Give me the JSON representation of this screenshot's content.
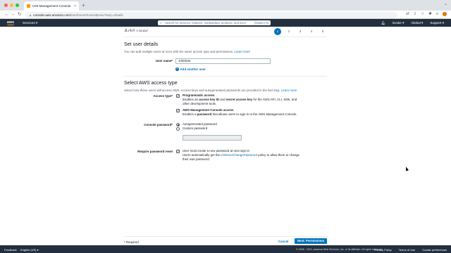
{
  "browser": {
    "tab_title": "IAM Management Console",
    "tab_close": "×",
    "new_tab": "+",
    "url_host": "console.aws.amazon.com",
    "url_path": "/iam/home#/users$new?step=details",
    "back": "←",
    "forward": "→",
    "reload": "↻",
    "traffic_colors": [
      "#ff5f57",
      "#febc2e",
      "#28c840"
    ]
  },
  "aws_nav": {
    "logo": "aws",
    "services": "Services ▾",
    "search_placeholder": "Search for services, features, marketplace products, and docs",
    "search_shortcut": "[Option+S]",
    "user": "invoke ▾",
    "region": "Global ▾",
    "support": "Support ▾"
  },
  "page": {
    "title": "Add user",
    "steps": [
      "1",
      "2",
      "3",
      "4",
      "5"
    ],
    "active_step": "1",
    "set_user_details": {
      "heading": "Set user details",
      "description": "You can add multiple users at once with the same access type and permissions.",
      "learn_more": "Learn more",
      "user_name_label": "User name*",
      "user_name_value": "JohnDoe",
      "add_another_user": "Add another user"
    },
    "access_type": {
      "heading": "Select AWS access type",
      "description": "Select how these users will access AWS. Access keys and autogenerated passwords are provided in the last step.",
      "learn_more": "Learn more",
      "label": "Access type*",
      "programmatic": {
        "checked": true,
        "title": "Programmatic access",
        "line1_pre": "Enables an ",
        "line1_b1": "access key ID",
        "line1_mid": " and ",
        "line1_b2": "secret access key",
        "line1_post": " for the AWS API, CLI, SDK, and",
        "line2": "other development tools."
      },
      "console": {
        "checked": true,
        "title": "AWS Management Console access",
        "line1_pre": "Enables a ",
        "line1_b": "password",
        "line1_post": " that allows users to sign-in to the AWS Management Console."
      }
    },
    "console_password": {
      "label": "Console password*",
      "autogenerated": "Autogenerated password",
      "custom": "Custom password"
    },
    "require_reset": {
      "label": "Require password reset",
      "checked": true,
      "line1": "User must create a new password at next sign-in",
      "line2_pre": "Users automatically get the ",
      "line2_link": "IAMUserChangePassword",
      "line2_post": " policy to allow them to change",
      "line3": "their own password."
    },
    "required_note": "* Required",
    "cancel": "Cancel",
    "next": "Next: Permissions"
  },
  "footer": {
    "feedback": "Feedback",
    "language": "English (US) ▾",
    "copyright": "© 2008 - 2021, Amazon Web Services, Inc. or its affiliates. All rights reserved.",
    "privacy": "Privacy Policy",
    "terms": "Terms of Use",
    "cookies": "Cookie preferences"
  },
  "colors": {
    "aws_nav_bg": "#232f3e",
    "aws_orange": "#ff9900",
    "link_blue": "#0073bb"
  }
}
